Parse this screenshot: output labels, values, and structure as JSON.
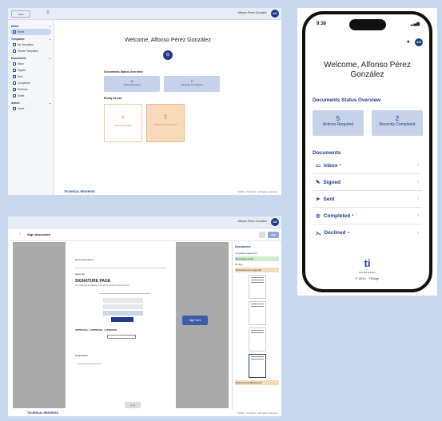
{
  "desktop": {
    "welcome": "Welcome, Alfonso Pérez González",
    "user_name": "Alfonso Pérez González",
    "avatar_initials": "AG",
    "sidebar": {
      "sections": [
        {
          "title": "Home",
          "items": [
            "Home"
          ]
        },
        {
          "title": "Templates",
          "items": [
            "My Templates",
            "Shared Templates"
          ]
        },
        {
          "title": "Documents",
          "items": [
            "Inbox",
            "Signed",
            "Sent",
            "Completed",
            "Declined",
            "Drafts"
          ]
        },
        {
          "title": "Admin",
          "items": [
            "Users"
          ]
        }
      ]
    },
    "status_title": "Documents Status Overview",
    "stats": [
      {
        "value": "5",
        "label": "Action Required"
      },
      {
        "value": "2",
        "label": "Recently Completed"
      }
    ],
    "ready_title": "Ready to use",
    "actions": [
      "Create template",
      "Upload new document"
    ],
    "footer_brand": "TECHNICAL RESERVED",
    "footer_right": "©2024 · Fluidsign · All rights reserved"
  },
  "phone": {
    "time": "9:38",
    "welcome": "Welcome, Alfonso Pérez González",
    "avatar_initials": "AG",
    "status_title": "Documents Status Overview",
    "stats": [
      {
        "value": "5",
        "label": "Actions Required"
      },
      {
        "value": "2",
        "label": "Recently Completed"
      }
    ],
    "documents_title": "Documents",
    "items": [
      {
        "label": "Inbox",
        "dot": true
      },
      {
        "label": "Signed",
        "dot": false
      },
      {
        "label": "Sent",
        "dot": false
      },
      {
        "label": "Completed",
        "dot": true
      },
      {
        "label": "Declined",
        "dot": true
      }
    ],
    "footer_copyright": "© 2024 · TSSign",
    "logo_sub": "Technical Solutions"
  },
  "sign": {
    "title": "Sign document",
    "user_name": "Alfonso Pérez González",
    "avatar_initials": "AG",
    "sign_button": "Sign",
    "panel_title": "Documents",
    "panel_items": [
      "Template-request-(1)",
      "Document-1.pdf",
      "To sign",
      "Document-1-to-sign.pdf"
    ],
    "page_heading": "SIGNATURE PAGE",
    "page_label1": "Document Name",
    "page_label2": "Approval",
    "page_note": "The undersigned agrees to the terms stated in this document.",
    "approval": "APPROVAL / APPROVAL / APPROVE",
    "reg_label": "Registration",
    "sign_here": "Sign Here",
    "page_nav": "1 / 1",
    "footer_brand": "TECHNICAL RESERVED",
    "footer_right": "©2024 · Fluidsign · All rights reserved",
    "last_file": "Document-Fallbacks.pdf"
  }
}
